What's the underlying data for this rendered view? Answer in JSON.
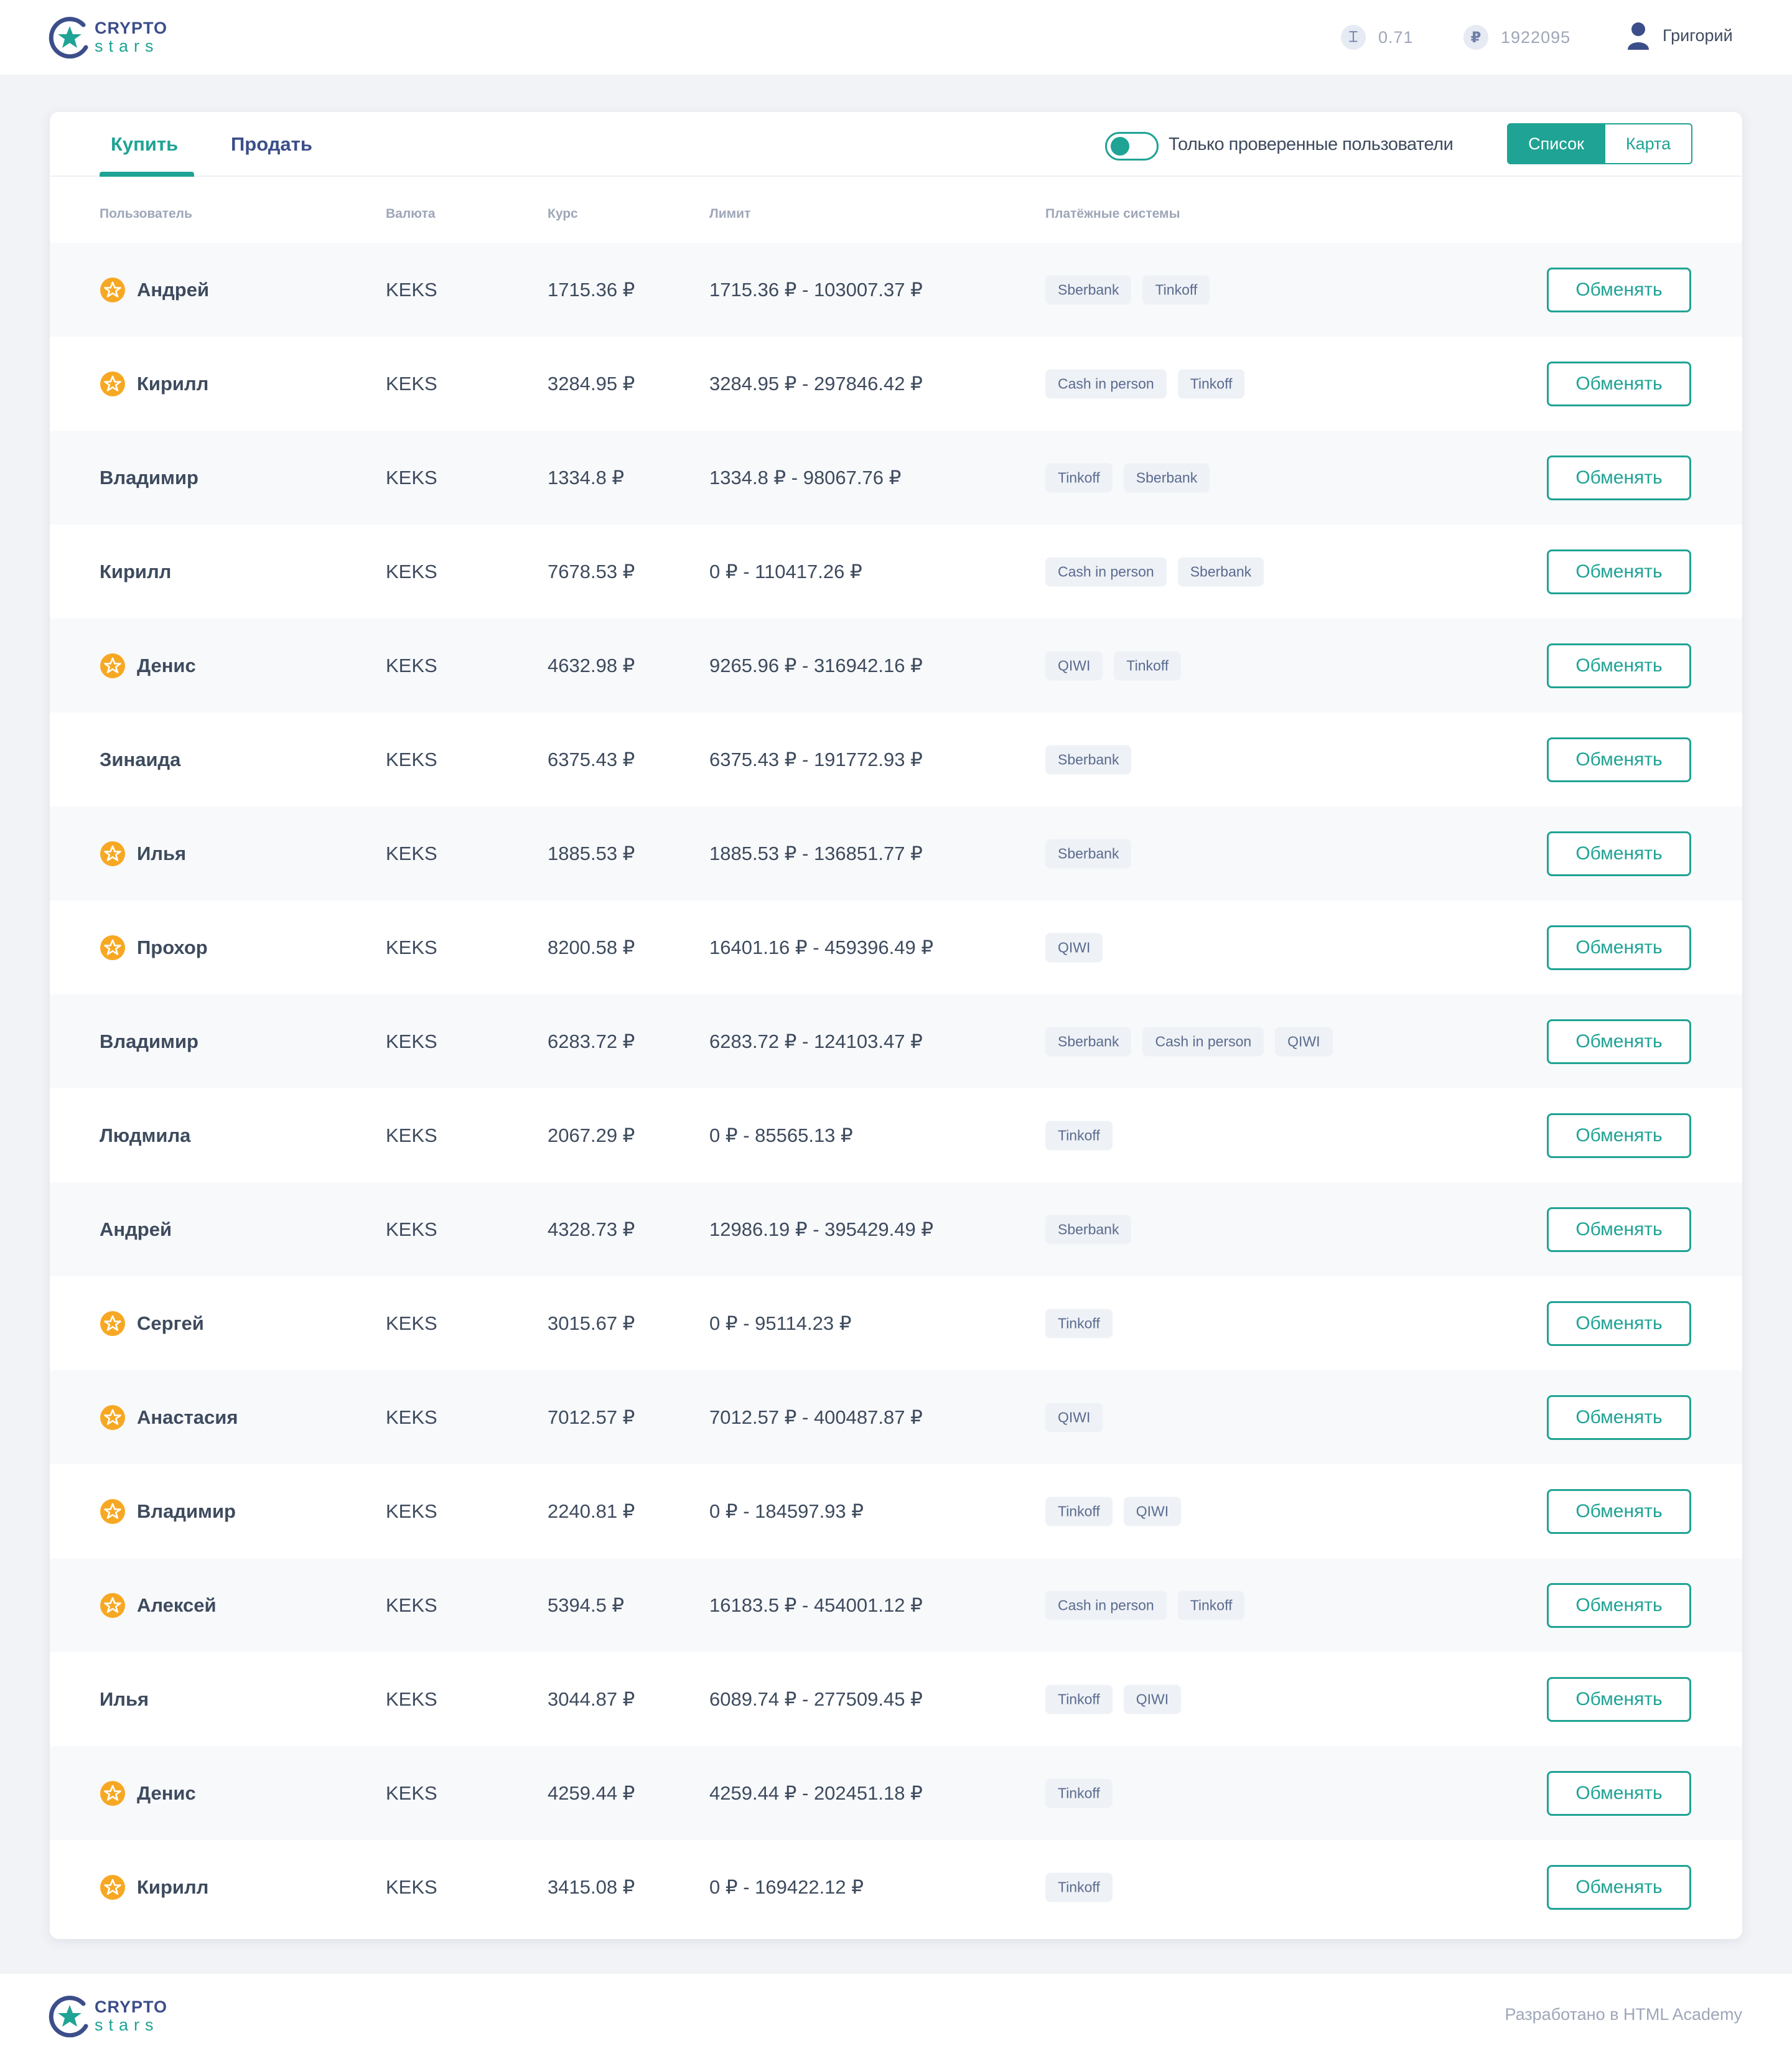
{
  "brand": {
    "line1": "CRYPTO",
    "line2": "stars"
  },
  "header": {
    "keks_balance": "0.71",
    "keks_icon": "keks-currency-icon",
    "rub_balance": "1922095",
    "rub_icon": "ruble-icon",
    "user_name": "Григорий"
  },
  "tabs": {
    "buy": "Купить",
    "sell": "Продать",
    "active": "buy"
  },
  "filter": {
    "verified_label": "Только проверенные пользователи",
    "verified_on": true
  },
  "view": {
    "list": "Список",
    "map": "Карта",
    "active": "list"
  },
  "table": {
    "headers": {
      "user": "Пользователь",
      "currency": "Валюта",
      "rate": "Курс",
      "limit": "Лимит",
      "payments": "Платёжные системы"
    },
    "action_label": "Обменять",
    "rows": [
      {
        "name": "Андрей",
        "verified": true,
        "currency": "KEKS",
        "rate": "1715.36 ₽",
        "limit": "1715.36 ₽ - 103007.37 ₽",
        "payments": [
          "Sberbank",
          "Tinkoff"
        ]
      },
      {
        "name": "Кирилл",
        "verified": true,
        "currency": "KEKS",
        "rate": "3284.95 ₽",
        "limit": "3284.95 ₽ - 297846.42 ₽",
        "payments": [
          "Cash in person",
          "Tinkoff"
        ]
      },
      {
        "name": "Владимир",
        "verified": false,
        "currency": "KEKS",
        "rate": "1334.8 ₽",
        "limit": "1334.8 ₽ - 98067.76 ₽",
        "payments": [
          "Tinkoff",
          "Sberbank"
        ]
      },
      {
        "name": "Кирилл",
        "verified": false,
        "currency": "KEKS",
        "rate": "7678.53 ₽",
        "limit": "0 ₽ - 110417.26 ₽",
        "payments": [
          "Cash in person",
          "Sberbank"
        ]
      },
      {
        "name": "Денис",
        "verified": true,
        "currency": "KEKS",
        "rate": "4632.98 ₽",
        "limit": "9265.96 ₽ - 316942.16 ₽",
        "payments": [
          "QIWI",
          "Tinkoff"
        ]
      },
      {
        "name": "Зинаида",
        "verified": false,
        "currency": "KEKS",
        "rate": "6375.43 ₽",
        "limit": "6375.43 ₽ - 191772.93 ₽",
        "payments": [
          "Sberbank"
        ]
      },
      {
        "name": "Илья",
        "verified": true,
        "currency": "KEKS",
        "rate": "1885.53 ₽",
        "limit": "1885.53 ₽ - 136851.77 ₽",
        "payments": [
          "Sberbank"
        ]
      },
      {
        "name": "Прохор",
        "verified": true,
        "currency": "KEKS",
        "rate": "8200.58 ₽",
        "limit": "16401.16 ₽ - 459396.49 ₽",
        "payments": [
          "QIWI"
        ]
      },
      {
        "name": "Владимир",
        "verified": false,
        "currency": "KEKS",
        "rate": "6283.72 ₽",
        "limit": "6283.72 ₽ - 124103.47 ₽",
        "payments": [
          "Sberbank",
          "Cash in person",
          "QIWI"
        ]
      },
      {
        "name": "Людмила",
        "verified": false,
        "currency": "KEKS",
        "rate": "2067.29 ₽",
        "limit": "0 ₽ - 85565.13 ₽",
        "payments": [
          "Tinkoff"
        ]
      },
      {
        "name": "Андрей",
        "verified": false,
        "currency": "KEKS",
        "rate": "4328.73 ₽",
        "limit": "12986.19 ₽ - 395429.49 ₽",
        "payments": [
          "Sberbank"
        ]
      },
      {
        "name": "Сергей",
        "verified": true,
        "currency": "KEKS",
        "rate": "3015.67 ₽",
        "limit": "0 ₽ - 95114.23 ₽",
        "payments": [
          "Tinkoff"
        ]
      },
      {
        "name": "Анастасия",
        "verified": true,
        "currency": "KEKS",
        "rate": "7012.57 ₽",
        "limit": "7012.57 ₽ - 400487.87 ₽",
        "payments": [
          "QIWI"
        ]
      },
      {
        "name": "Владимир",
        "verified": true,
        "currency": "KEKS",
        "rate": "2240.81 ₽",
        "limit": "0 ₽ - 184597.93 ₽",
        "payments": [
          "Tinkoff",
          "QIWI"
        ]
      },
      {
        "name": "Алексей",
        "verified": true,
        "currency": "KEKS",
        "rate": "5394.5 ₽",
        "limit": "16183.5 ₽ - 454001.12 ₽",
        "payments": [
          "Cash in person",
          "Tinkoff"
        ]
      },
      {
        "name": "Илья",
        "verified": false,
        "currency": "KEKS",
        "rate": "3044.87 ₽",
        "limit": "6089.74 ₽ - 277509.45 ₽",
        "payments": [
          "Tinkoff",
          "QIWI"
        ]
      },
      {
        "name": "Денис",
        "verified": true,
        "currency": "KEKS",
        "rate": "4259.44 ₽",
        "limit": "4259.44 ₽ - 202451.18 ₽",
        "payments": [
          "Tinkoff"
        ]
      },
      {
        "name": "Кирилл",
        "verified": true,
        "currency": "KEKS",
        "rate": "3415.08 ₽",
        "limit": "0 ₽ - 169422.12 ₽",
        "payments": [
          "Tinkoff"
        ]
      }
    ]
  },
  "footer": {
    "credit": "Разработано в HTML Academy"
  },
  "colors": {
    "accent": "#1fa394",
    "brand_dark": "#3c4e8a",
    "star": "#f7a823",
    "row_alt": "#f8f9fb"
  }
}
